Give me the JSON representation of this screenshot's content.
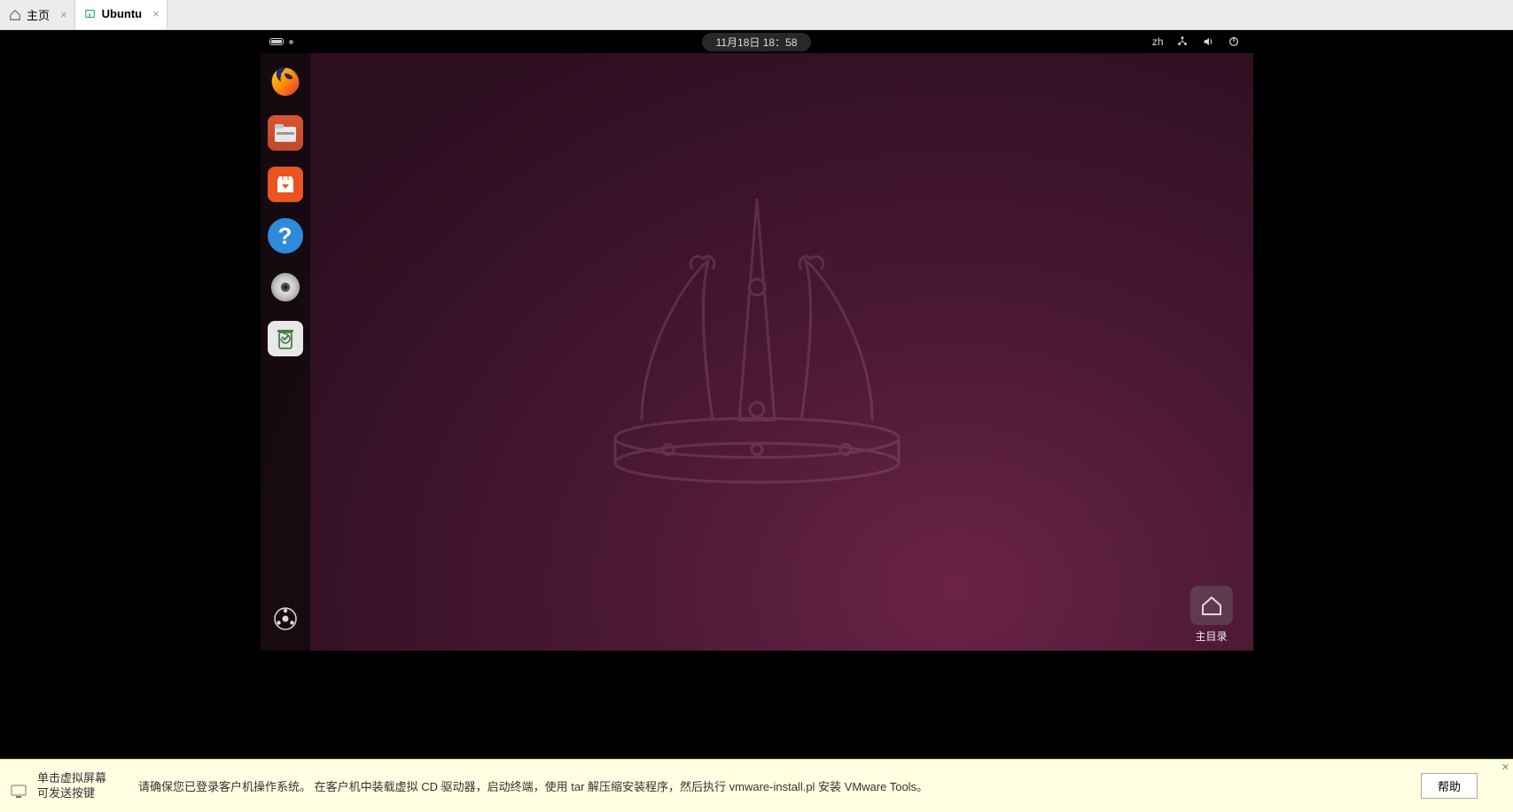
{
  "tabs": [
    {
      "label": "主页",
      "active": false
    },
    {
      "label": "Ubuntu",
      "active": true
    }
  ],
  "panel": {
    "datetime": "11月18日  18：58",
    "input_method": "zh"
  },
  "dock": {
    "items": [
      {
        "name": "firefox"
      },
      {
        "name": "files"
      },
      {
        "name": "software"
      },
      {
        "name": "help"
      },
      {
        "name": "disc"
      },
      {
        "name": "trash"
      }
    ]
  },
  "desktop": {
    "home_label": "主目录"
  },
  "notification": {
    "hint": "单击虚拟屏幕\n可发送按键",
    "message": "请确保您已登录客户机操作系统。 在客户机中装载虚拟 CD 驱动器，启动终端，使用 tar 解压缩安装程序，然后执行 vmware-install.pl 安装 VMware Tools。",
    "help_button": "帮助"
  }
}
